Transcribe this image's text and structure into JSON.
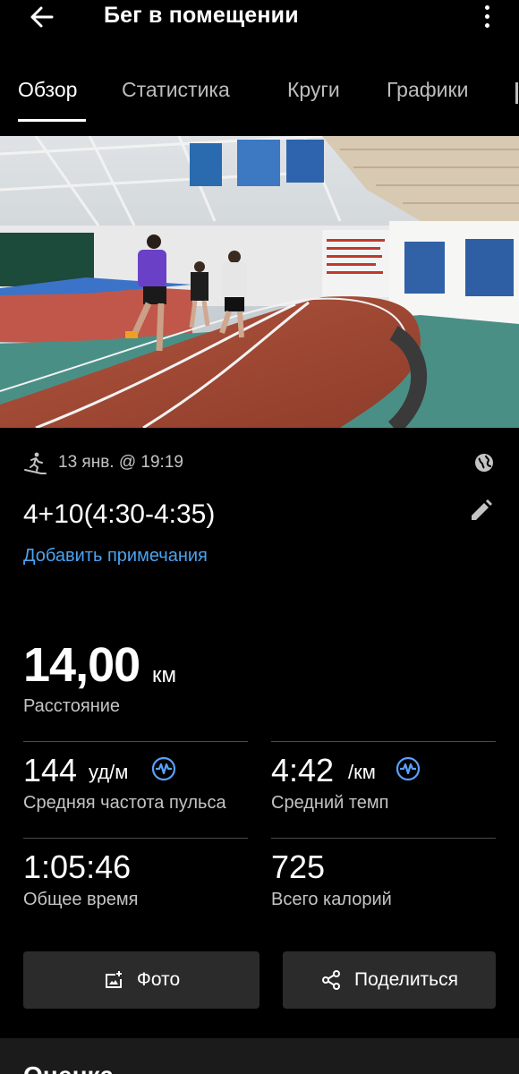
{
  "header": {
    "title": "Бег в помещении",
    "back_icon": "arrow-left-icon",
    "more_icon": "more-vert-icon"
  },
  "tabs": [
    {
      "label": "Обзор",
      "active": true
    },
    {
      "label": "Статистика",
      "active": false
    },
    {
      "label": "Круги",
      "active": false
    },
    {
      "label": "Графики",
      "active": false
    }
  ],
  "activity": {
    "type_icon": "treadmill-icon",
    "date": "13 янв. @ 19:19",
    "privacy_icon": "globe-icon",
    "name": "4+10(4:30-4:35)",
    "edit_icon": "pencil-icon",
    "add_notes": "Добавить примечания"
  },
  "distance": {
    "value": "14,00",
    "unit": "км",
    "label": "Расстояние"
  },
  "stats": {
    "heart_rate": {
      "value": "144",
      "unit": "уд/м",
      "label": "Средняя частота пульса",
      "icon": "waveform-icon"
    },
    "pace": {
      "value": "4:42",
      "unit": "/км",
      "label": "Средний темп",
      "icon": "waveform-icon"
    },
    "time": {
      "value": "1:05:46",
      "label": "Общее время"
    },
    "calories": {
      "value": "725",
      "label": "Всего калорий"
    }
  },
  "actions": {
    "photo": {
      "label": "Фото",
      "icon": "add-photo-icon"
    },
    "share": {
      "label": "Поделиться",
      "icon": "share-icon"
    }
  },
  "section": {
    "title": "Оценка"
  },
  "colors": {
    "background": "#000000",
    "link": "#4aa3f0",
    "accent_icon": "#5aa0ff",
    "button": "#2b2b2b"
  }
}
